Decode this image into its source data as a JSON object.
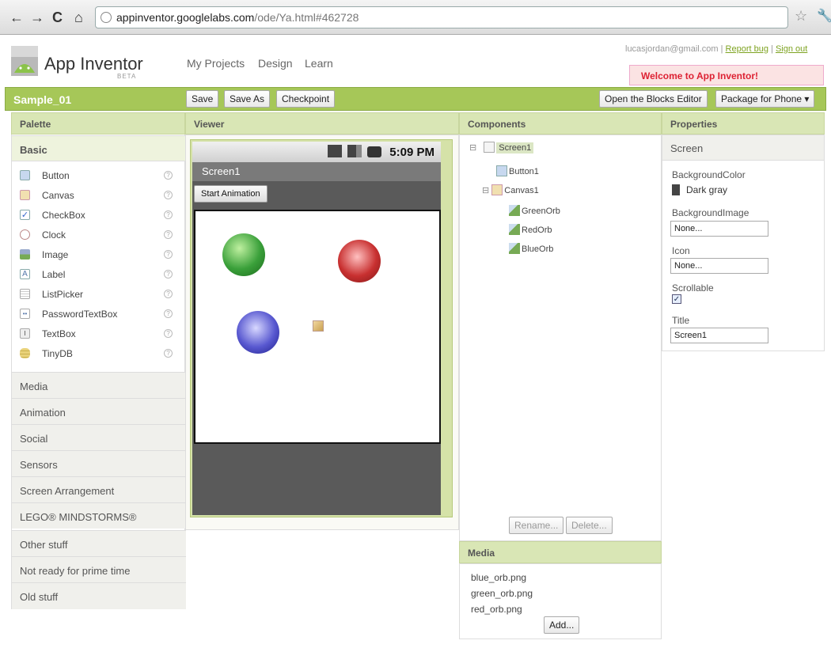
{
  "browser": {
    "url_host": "appinventor.googlelabs.com",
    "url_path": "/ode/Ya.html#462728"
  },
  "header": {
    "app_name": "App Inventor",
    "beta": "BETA",
    "nav": [
      "My Projects",
      "Design",
      "Learn"
    ],
    "user_email": "lucasjordan@gmail.com",
    "report_bug": "Report bug",
    "sign_out": "Sign out",
    "welcome": "Welcome to App Inventor!"
  },
  "projectbar": {
    "name": "Sample_01",
    "save": "Save",
    "save_as": "Save As",
    "checkpoint": "Checkpoint",
    "blocks_editor": "Open the Blocks Editor",
    "package": "Package for Phone ▾"
  },
  "palette": {
    "title": "Palette",
    "basic": "Basic",
    "items": [
      "Button",
      "Canvas",
      "CheckBox",
      "Clock",
      "Image",
      "Label",
      "ListPicker",
      "PasswordTextBox",
      "TextBox",
      "TinyDB"
    ],
    "sections": [
      "Media",
      "Animation",
      "Social",
      "Sensors",
      "Screen Arrangement",
      "LEGO® MINDSTORMS®",
      "Other stuff",
      "Not ready for prime time",
      "Old stuff"
    ]
  },
  "viewer": {
    "title": "Viewer",
    "time": "5:09 PM",
    "screen_title": "Screen1",
    "start_button": "Start Animation"
  },
  "components": {
    "title": "Components",
    "screen": "Screen1",
    "button": "Button1",
    "canvas": "Canvas1",
    "sprites": [
      "GreenOrb",
      "RedOrb",
      "BlueOrb"
    ],
    "rename": "Rename...",
    "delete": "Delete..."
  },
  "media": {
    "title": "Media",
    "files": [
      "blue_orb.png",
      "green_orb.png",
      "red_orb.png"
    ],
    "add": "Add..."
  },
  "properties": {
    "title": "Properties",
    "component": "Screen",
    "bgcolor_label": "BackgroundColor",
    "bgcolor_value": "Dark gray",
    "bgimage_label": "BackgroundImage",
    "bgimage_value": "None...",
    "icon_label": "Icon",
    "icon_value": "None...",
    "scrollable_label": "Scrollable",
    "title_label": "Title",
    "title_value": "Screen1"
  },
  "colors": {
    "accent": "#a6c758",
    "welcome": "#d22233"
  }
}
